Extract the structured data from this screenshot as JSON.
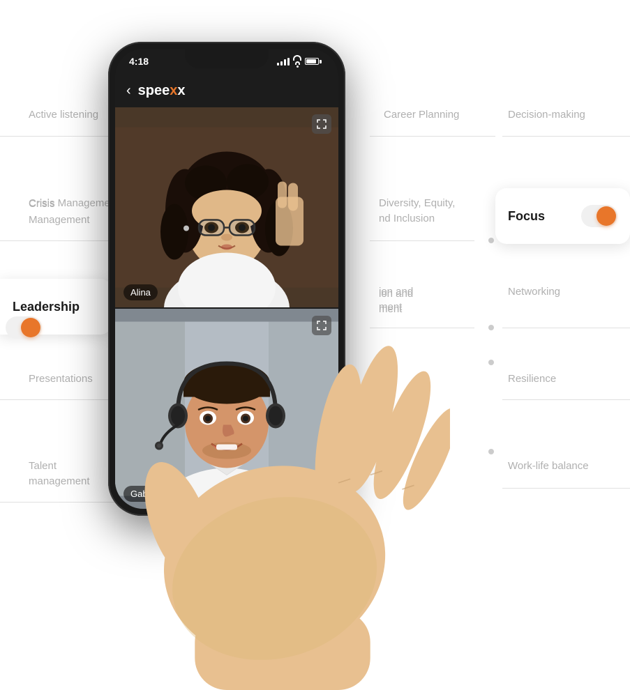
{
  "app": {
    "title": "speexx",
    "title_x": "x",
    "time": "4:18"
  },
  "skills": {
    "active_listening": "Active listening",
    "career_planning": "Career Planning",
    "decision_making": "Decision-making",
    "crisis_management": "Crisis Management",
    "diversity_equity": "Diversity, Equity,",
    "and_inclusion": "nd Inclusion",
    "leadership": "Leadership",
    "innovation_and": "ion and",
    "management": "ment",
    "networking": "Networking",
    "presentations": "Presentations",
    "resilience": "Resilience",
    "talent_management_1": "Talent",
    "talent_management_2": "management",
    "work_life_balance": "Work-life balance"
  },
  "cards": {
    "focus": {
      "title": "Focus",
      "toggle_state": "on"
    },
    "leadership": {
      "title": "Leadership",
      "toggle_state": "on"
    }
  },
  "video": {
    "participants": [
      {
        "name": "Alina"
      },
      {
        "name": "Gabriel"
      }
    ]
  },
  "icons": {
    "back": "‹",
    "expand": "⤢",
    "wifi": "wifi-icon",
    "battery": "battery-icon",
    "signal": "signal-icon"
  }
}
